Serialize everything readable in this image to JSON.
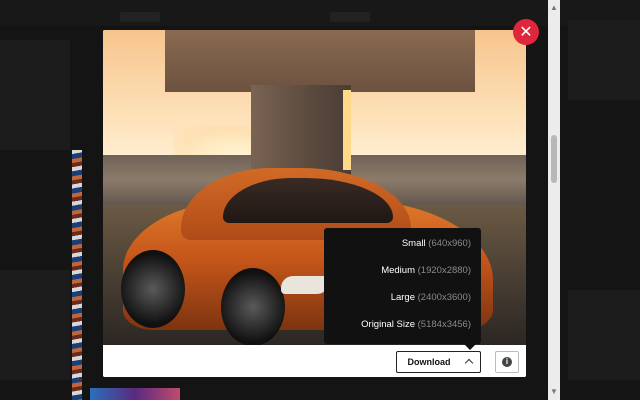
{
  "modal": {
    "close_glyph": "✕",
    "image_alt": "Orange coupe parked under concrete bridge at sunset"
  },
  "download_bar": {
    "download_label": "Download",
    "info_glyph": "i"
  },
  "size_menu": {
    "items": [
      {
        "label": "Small",
        "dims": "(640x960)"
      },
      {
        "label": "Medium",
        "dims": "(1920x2880)"
      },
      {
        "label": "Large",
        "dims": "(2400x3600)"
      },
      {
        "label": "Original Size",
        "dims": "(5184x3456)"
      }
    ]
  },
  "colors": {
    "close_button": "#e0263a",
    "menu_background": "#111111",
    "menu_dims_text": "#8a8a8a"
  },
  "icons": [
    "close-icon",
    "chevron-up-icon",
    "info-icon"
  ]
}
